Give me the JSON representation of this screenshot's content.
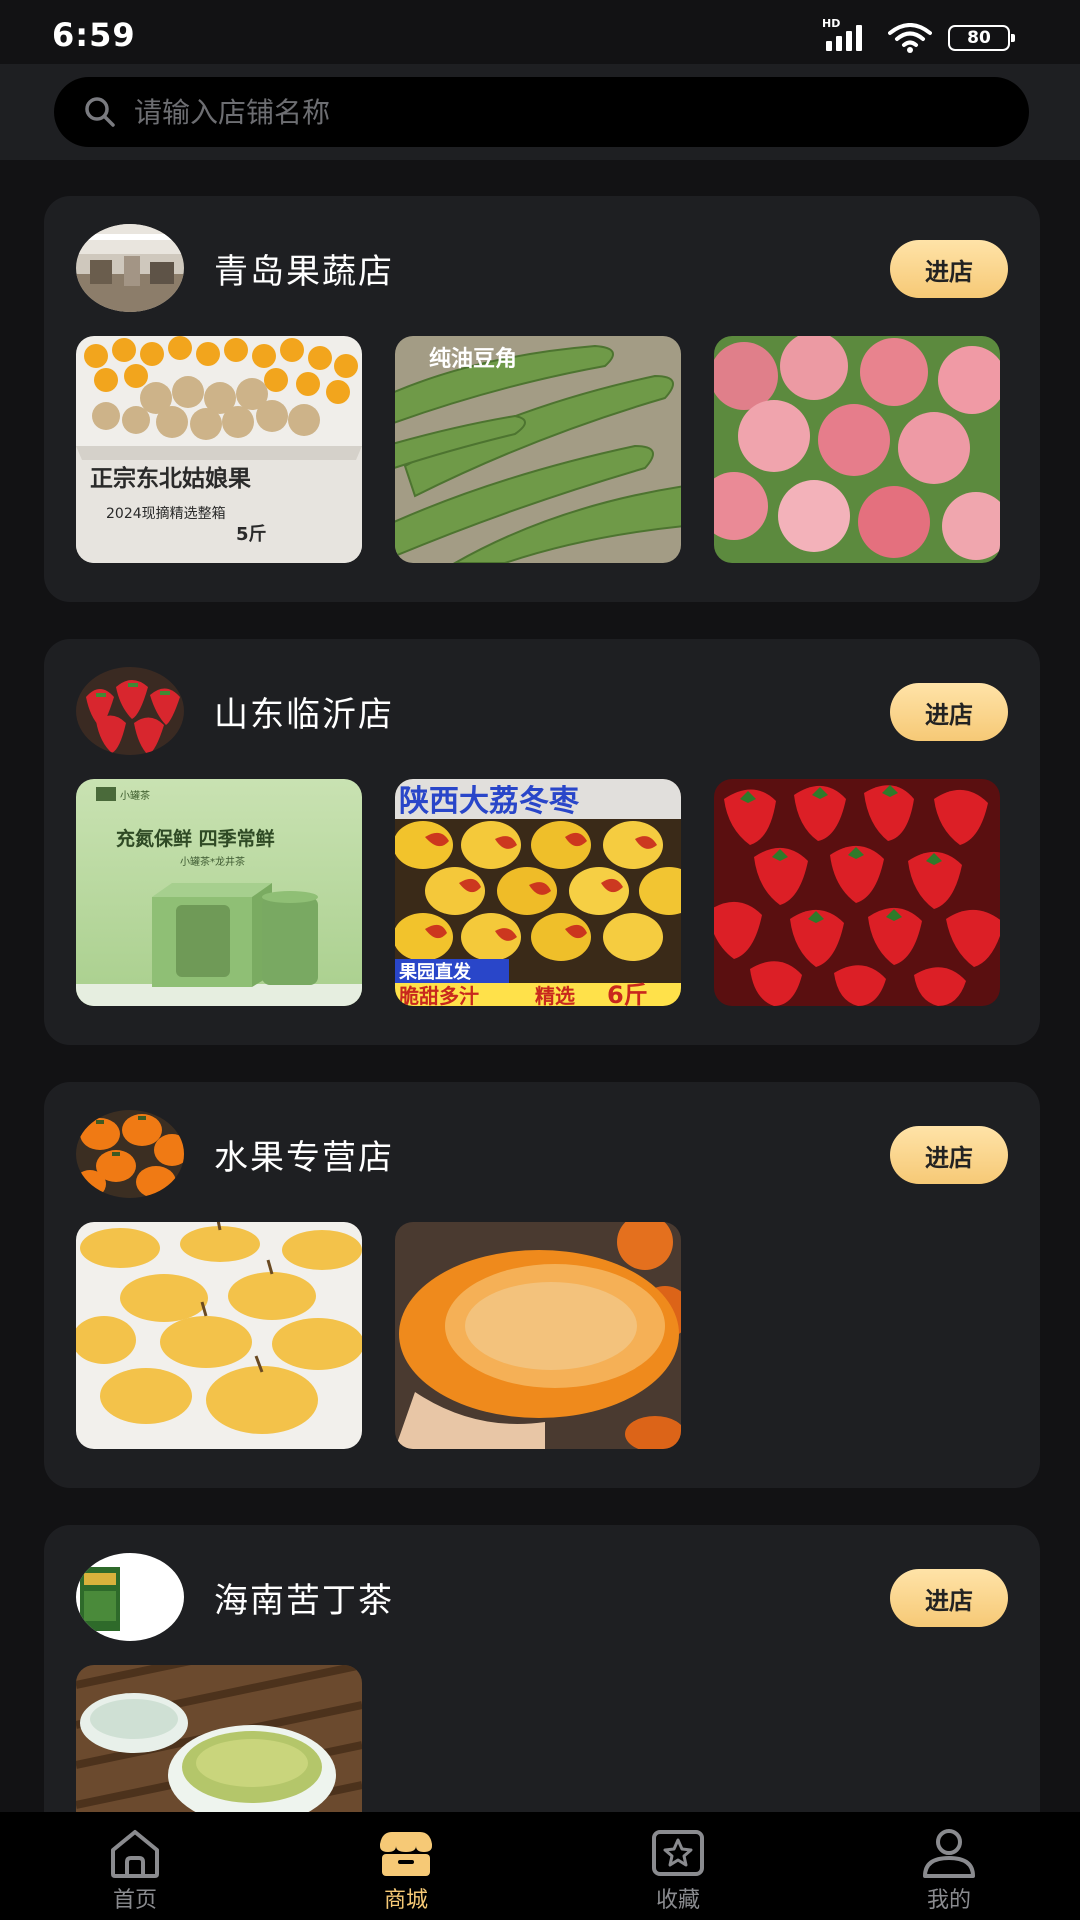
{
  "status_bar": {
    "time": "6:59",
    "network_badge": "HD",
    "battery": "80"
  },
  "search": {
    "placeholder": "请输入店铺名称",
    "value": ""
  },
  "shops": [
    {
      "name": "青岛果蔬店",
      "enter_label": "进店",
      "products": [
        {
          "image": "golden-berries-box",
          "overlay_title": "正宗东北姑娘果",
          "overlay_sub": "2024现摘精选整箱",
          "overlay_weight": "5斤"
        },
        {
          "image": "green-beans",
          "overlay_title": "纯油豆角"
        },
        {
          "image": "red-apples"
        }
      ]
    },
    {
      "name": "山东临沂店",
      "enter_label": "进店",
      "products": [
        {
          "image": "green-tea-cans",
          "overlay_brand": "小罐茶",
          "overlay_title": "充氮保鲜 四季常鲜",
          "overlay_sub": "小罐茶*龙井茶"
        },
        {
          "image": "winter-jujubes",
          "overlay_title": "陕西大荔冬枣",
          "overlay_tag": "果园直发",
          "overlay_slogan": "脆甜多汁",
          "overlay_pick": "精选",
          "overlay_weight": "6斤"
        },
        {
          "image": "strawberries"
        }
      ]
    },
    {
      "name": "水果专营店",
      "enter_label": "进店",
      "products": [
        {
          "image": "yellow-pears"
        },
        {
          "image": "persimmon"
        }
      ]
    },
    {
      "name": "海南苦丁茶",
      "enter_label": "进店",
      "products": [
        {
          "image": "tea-cups"
        }
      ]
    }
  ],
  "bottom_nav": [
    {
      "label": "首页",
      "icon": "home-icon",
      "active": false
    },
    {
      "label": "商城",
      "icon": "store-icon",
      "active": true
    },
    {
      "label": "收藏",
      "icon": "favorite-star-icon",
      "active": false
    },
    {
      "label": "我的",
      "icon": "user-icon",
      "active": false
    }
  ],
  "colors": {
    "background": "#121214",
    "card": "#1e1f22",
    "accent": "#f6c976",
    "nav_inactive": "#8a8b8f"
  }
}
